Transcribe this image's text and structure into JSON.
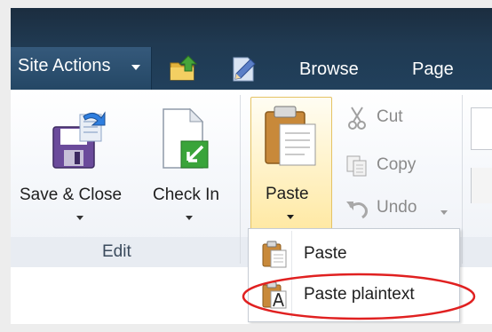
{
  "top_bar": {
    "site_actions_label": "Site Actions",
    "tabs": [
      {
        "label": "Browse"
      },
      {
        "label": "Page"
      }
    ],
    "icons": [
      "navigate-up-icon",
      "edit-page-icon"
    ]
  },
  "ribbon": {
    "edit_group": {
      "save_close_label": "Save & Close",
      "check_in_label": "Check In",
      "group_label": "Edit"
    },
    "clipboard_group": {
      "paste_label": "Paste",
      "cut_label": "Cut",
      "copy_label": "Copy",
      "undo_label": "Undo"
    }
  },
  "paste_menu": {
    "items": [
      {
        "label": "Paste",
        "icon": "paste-icon"
      },
      {
        "label": "Paste plaintext",
        "icon": "paste-plaintext-icon"
      }
    ]
  },
  "colors": {
    "top_bar": "#21405c",
    "paste_highlight": "#ffe9a4",
    "annotation_circle": "#e02020"
  }
}
